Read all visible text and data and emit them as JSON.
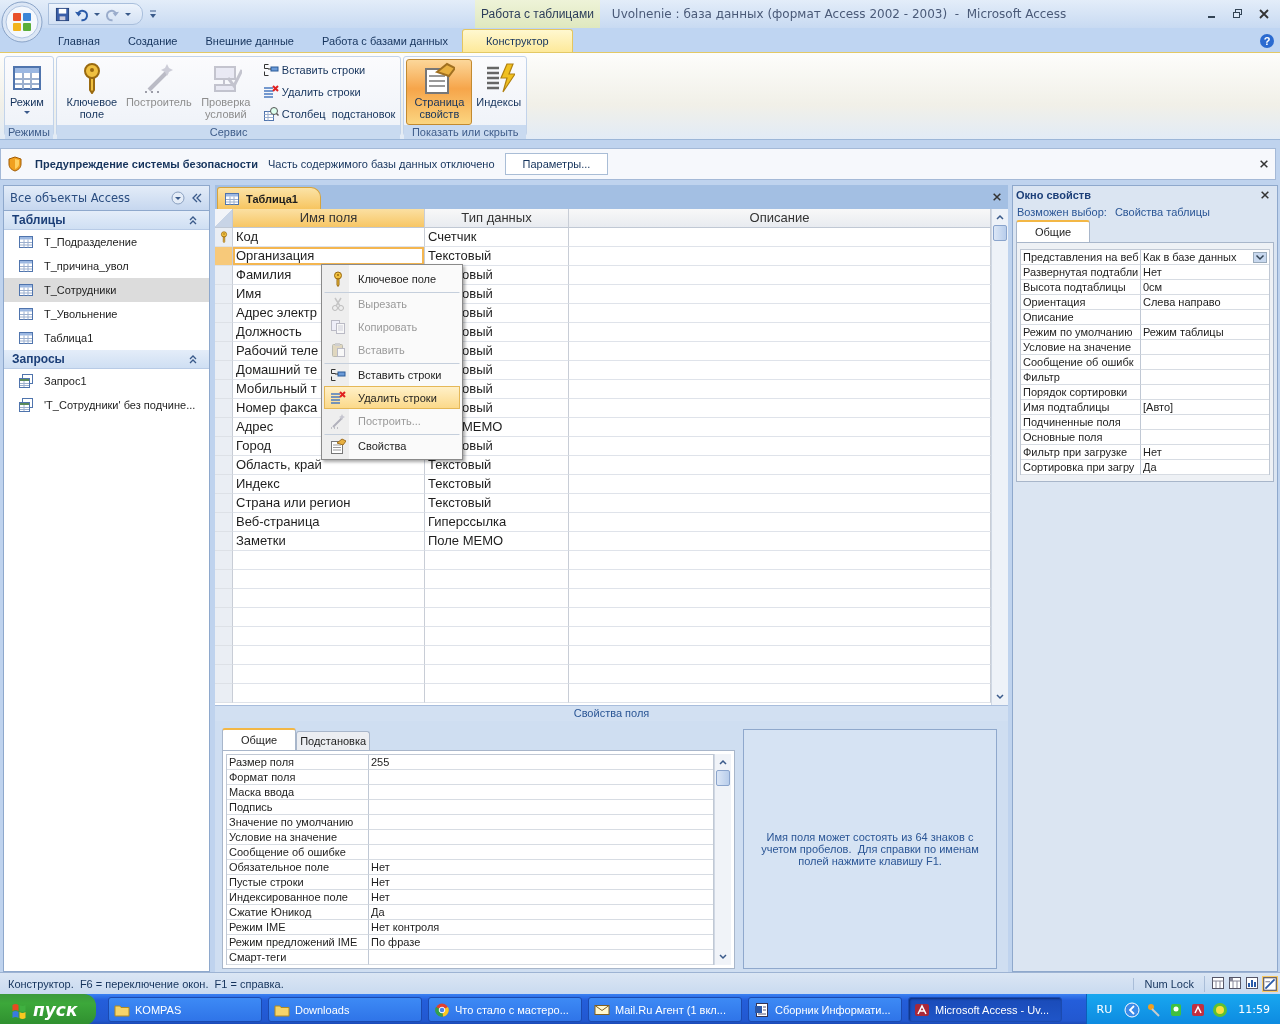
{
  "window": {
    "title": "Uvolnenie : база данных (формат Access 2002 - 2003)  -  Microsoft Access",
    "contextual_label": "Работа с таблицами",
    "help": "?"
  },
  "ribbon": {
    "tabs": [
      {
        "label": "Главная",
        "selected": false
      },
      {
        "label": "Создание",
        "selected": false
      },
      {
        "label": "Внешние данные",
        "selected": false
      },
      {
        "label": "Работа с базами данных",
        "selected": false
      },
      {
        "label": "Конструктор",
        "selected": true
      }
    ],
    "groups": [
      {
        "label": "Режимы",
        "buttons": [
          {
            "label": "Режим",
            "kind": "large",
            "dropdown": true,
            "disabled": false,
            "selected": false
          }
        ]
      },
      {
        "label": "Сервис",
        "buttons": [
          {
            "label": "Ключевое поле",
            "kind": "large",
            "dropdown": false,
            "disabled": false,
            "selected": false
          },
          {
            "label": "Построитель",
            "kind": "large",
            "dropdown": false,
            "disabled": true,
            "selected": false
          },
          {
            "label": "Проверка условий",
            "kind": "large",
            "dropdown": false,
            "disabled": true,
            "selected": false
          },
          {
            "label": "Вставить строки",
            "kind": "small",
            "dropdown": false,
            "disabled": false,
            "selected": false
          },
          {
            "label": "Удалить строки",
            "kind": "small",
            "dropdown": false,
            "disabled": false,
            "selected": false
          },
          {
            "label": "Столбец  подстановок",
            "kind": "small",
            "dropdown": false,
            "disabled": false,
            "selected": false
          }
        ]
      },
      {
        "label": "Показать или скрыть",
        "buttons": [
          {
            "label": "Страница свойств",
            "kind": "large",
            "dropdown": false,
            "disabled": false,
            "selected": true
          },
          {
            "label": "Индексы",
            "kind": "large",
            "dropdown": false,
            "disabled": false,
            "selected": false
          }
        ]
      }
    ]
  },
  "security_bar": {
    "title": "Предупреждение системы безопасности",
    "message": "Часть содержимого базы данных отключено",
    "button": "Параметры..."
  },
  "nav_pane": {
    "title": "Все объекты Access",
    "groups": [
      {
        "label": "Таблицы",
        "expanded": true,
        "items": [
          {
            "label": "T_Подразделение",
            "selected": false
          },
          {
            "label": "T_причина_увол",
            "selected": false
          },
          {
            "label": "T_Сотрудники",
            "selected": true
          },
          {
            "label": "T_Увольнение",
            "selected": false
          },
          {
            "label": "Таблица1",
            "selected": false
          }
        ]
      },
      {
        "label": "Запросы",
        "expanded": true,
        "items": [
          {
            "label": "Запрос1",
            "selected": false
          },
          {
            "label": "'T_Сотрудники' без подчине...",
            "selected": false
          }
        ]
      }
    ]
  },
  "document": {
    "tab": "Таблица1",
    "columns": [
      "Имя поля",
      "Тип данных",
      "Описание"
    ],
    "rows": [
      {
        "field": "Код",
        "type": "Счетчик",
        "primary_key": true,
        "selected": false,
        "under_menu": false
      },
      {
        "field": "Организация",
        "type": "Текстовый",
        "primary_key": false,
        "selected": true,
        "under_menu": false
      },
      {
        "field": "Фамилия",
        "type": "овый",
        "primary_key": false,
        "selected": false,
        "under_menu": true
      },
      {
        "field": "Имя",
        "type": "овый",
        "primary_key": false,
        "selected": false,
        "under_menu": true
      },
      {
        "field": "Адрес электр",
        "type": "овый",
        "primary_key": false,
        "selected": false,
        "under_menu": true
      },
      {
        "field": "Должность",
        "type": "овый",
        "primary_key": false,
        "selected": false,
        "under_menu": true
      },
      {
        "field": "Рабочий теле",
        "type": "овый",
        "primary_key": false,
        "selected": false,
        "under_menu": true
      },
      {
        "field": "Домашний те",
        "type": "овый",
        "primary_key": false,
        "selected": false,
        "under_menu": true
      },
      {
        "field": "Мобильный т",
        "type": "овый",
        "primary_key": false,
        "selected": false,
        "under_menu": true
      },
      {
        "field": "Номер факса",
        "type": "овый",
        "primary_key": false,
        "selected": false,
        "under_menu": true
      },
      {
        "field": "Адрес",
        "type": "MEMO",
        "primary_key": false,
        "selected": false,
        "under_menu": true
      },
      {
        "field": "Город",
        "type": "овый",
        "primary_key": false,
        "selected": false,
        "under_menu": true
      },
      {
        "field": "Область, край",
        "type": "Текстовый",
        "primary_key": false,
        "selected": false,
        "under_menu": false
      },
      {
        "field": "Индекс",
        "type": "Текстовый",
        "primary_key": false,
        "selected": false,
        "under_menu": false
      },
      {
        "field": "Страна или регион",
        "type": "Текстовый",
        "primary_key": false,
        "selected": false,
        "under_menu": false
      },
      {
        "field": "Веб-страница",
        "type": "Гиперссылка",
        "primary_key": false,
        "selected": false,
        "under_menu": false
      },
      {
        "field": "Заметки",
        "type": "Поле MEMO",
        "primary_key": false,
        "selected": false,
        "under_menu": false
      }
    ]
  },
  "context_menu": {
    "items": [
      {
        "label": "Ключевое поле",
        "disabled": false,
        "highlighted": false,
        "separator_before": false
      },
      {
        "label": "Вырезать",
        "disabled": true,
        "highlighted": false,
        "separator_before": true
      },
      {
        "label": "Копировать",
        "disabled": true,
        "highlighted": false,
        "separator_before": false
      },
      {
        "label": "Вставить",
        "disabled": true,
        "highlighted": false,
        "separator_before": false
      },
      {
        "label": "Вставить строки",
        "disabled": false,
        "highlighted": false,
        "separator_before": true
      },
      {
        "label": "Удалить строки",
        "disabled": false,
        "highlighted": true,
        "separator_before": false
      },
      {
        "label": "Построить...",
        "disabled": true,
        "highlighted": false,
        "separator_before": false
      },
      {
        "label": "Свойства",
        "disabled": false,
        "highlighted": false,
        "separator_before": true
      }
    ]
  },
  "field_properties": {
    "title": "Свойства поля",
    "tabs": [
      {
        "label": "Общие",
        "selected": true
      },
      {
        "label": "Подстановка",
        "selected": false
      }
    ],
    "rows": [
      {
        "name": "Размер поля",
        "value": "255"
      },
      {
        "name": "Формат поля",
        "value": ""
      },
      {
        "name": "Маска ввода",
        "value": ""
      },
      {
        "name": "Подпись",
        "value": ""
      },
      {
        "name": "Значение по умолчанию",
        "value": ""
      },
      {
        "name": "Условие на значение",
        "value": ""
      },
      {
        "name": "Сообщение об ошибке",
        "value": ""
      },
      {
        "name": "Обязательное поле",
        "value": "Нет"
      },
      {
        "name": "Пустые строки",
        "value": "Нет"
      },
      {
        "name": "Индексированное поле",
        "value": "Нет"
      },
      {
        "name": "Сжатие Юникод",
        "value": "Да"
      },
      {
        "name": "Режим IME",
        "value": "Нет контроля"
      },
      {
        "name": "Режим предложений IME",
        "value": "По фразе"
      },
      {
        "name": "Смарт-теги",
        "value": ""
      }
    ],
    "help": "Имя поля может состоять из 64 знаков с учетом пробелов.  Для справки по именам полей нажмите клавишу F1."
  },
  "property_sheet": {
    "title": "Окно свойств",
    "selection_label": "Возможен выбор:",
    "selection": "Свойства таблицы",
    "tabs": [
      {
        "label": "Общие",
        "selected": true
      }
    ],
    "rows": [
      {
        "name": "Представления на веб",
        "value": "Как в базе данных",
        "dropdown": true
      },
      {
        "name": "Развернутая подтабли",
        "value": "Нет",
        "dropdown": false
      },
      {
        "name": "Высота подтаблицы",
        "value": "0см",
        "dropdown": false
      },
      {
        "name": "Ориентация",
        "value": "Слева направо",
        "dropdown": false
      },
      {
        "name": "Описание",
        "value": "",
        "dropdown": false
      },
      {
        "name": "Режим по умолчанию",
        "value": "Режим таблицы",
        "dropdown": false
      },
      {
        "name": "Условие на значение",
        "value": "",
        "dropdown": false
      },
      {
        "name": "Сообщение об ошибк",
        "value": "",
        "dropdown": false
      },
      {
        "name": "Фильтр",
        "value": "",
        "dropdown": false
      },
      {
        "name": "Порядок сортировки",
        "value": "",
        "dropdown": false
      },
      {
        "name": "Имя подтаблицы",
        "value": "[Авто]",
        "dropdown": false
      },
      {
        "name": "Подчиненные поля",
        "value": "",
        "dropdown": false
      },
      {
        "name": "Основные поля",
        "value": "",
        "dropdown": false
      },
      {
        "name": "Фильтр при загрузке",
        "value": "Нет",
        "dropdown": false
      },
      {
        "name": "Сортировка при загру",
        "value": "Да",
        "dropdown": false
      }
    ]
  },
  "status_bar": {
    "text": "Конструктор.  F6 = переключение окон.  F1 = справка.",
    "num_lock": "Num Lock"
  },
  "taskbar": {
    "start": "пуск",
    "tasks": [
      {
        "label": "KOMPAS",
        "kind": "folder",
        "selected": false
      },
      {
        "label": "Downloads",
        "kind": "folder",
        "selected": false
      },
      {
        "label": "Что стало с мастеро...",
        "kind": "browser",
        "selected": false
      },
      {
        "label": "Mail.Ru Агент (1 вкл...",
        "kind": "mail",
        "selected": false
      },
      {
        "label": "Сборник Информати...",
        "kind": "document",
        "selected": false
      },
      {
        "label": "Microsoft Access - Uv...",
        "kind": "access",
        "selected": true
      }
    ],
    "language": "RU",
    "clock": "11:59"
  }
}
